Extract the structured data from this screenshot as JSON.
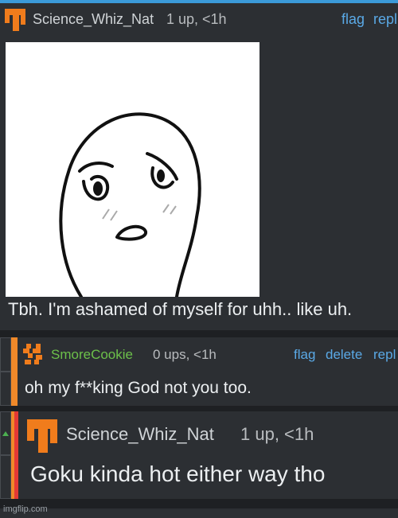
{
  "comment1": {
    "username": "Science_Whiz_Nat",
    "meta": "1 up, <1h",
    "actions": {
      "flag": "flag",
      "reply": "repl"
    },
    "body": "Tbh. I'm ashamed of myself for uhh.. like uh."
  },
  "comment2": {
    "username": "SmoreCookie",
    "meta": "0 ups, <1h",
    "actions": {
      "flag": "flag",
      "delete": "delete",
      "reply": "repl"
    },
    "body": "oh my f**king God not you too."
  },
  "comment3": {
    "username": "Science_Whiz_Nat",
    "meta": "1 up, <1h",
    "body": "Goku kinda hot either way tho"
  },
  "watermark": "imgflip.com",
  "colors": {
    "background": "#2c2f33",
    "link": "#5aa9e6",
    "orange_avatar": "#f07c1c",
    "green_username": "#6cc04a",
    "orange_bar": "#f0892a",
    "red_bar": "#e53935",
    "top_border": "#3b9ad9"
  },
  "icons": [
    "orange-avatar-icon",
    "cookie-avatar-icon",
    "upvote-arrow-icon"
  ]
}
